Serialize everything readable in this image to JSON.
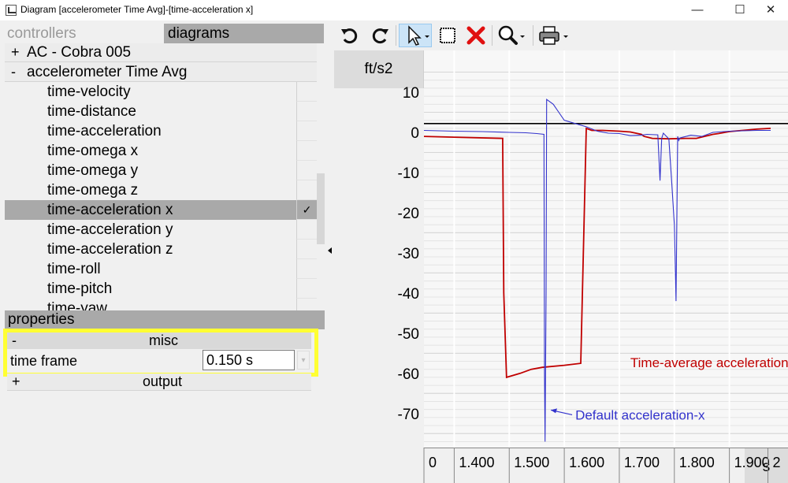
{
  "window": {
    "title": "Diagram [accelerometer Time Avg]-[time-acceleration x]",
    "minimize": "—",
    "maximize": "☐",
    "close": "✕"
  },
  "left": {
    "tabs": {
      "controllers": "controllers",
      "diagrams": "diagrams"
    },
    "tree": [
      {
        "expander": "+",
        "label": "AC - Cobra 005",
        "kind": "group",
        "checked": false
      },
      {
        "expander": "-",
        "label": "accelerometer Time Avg",
        "kind": "group",
        "checked": false
      },
      {
        "label": "time-velocity",
        "kind": "item",
        "checked": false
      },
      {
        "label": "time-distance",
        "kind": "item",
        "checked": false
      },
      {
        "label": "time-acceleration",
        "kind": "item",
        "checked": false
      },
      {
        "label": "time-omega x",
        "kind": "item",
        "checked": false
      },
      {
        "label": "time-omega y",
        "kind": "item",
        "checked": false
      },
      {
        "label": "time-omega z",
        "kind": "item",
        "checked": false
      },
      {
        "label": "time-acceleration x",
        "kind": "item",
        "checked": true,
        "check_mark": "✓"
      },
      {
        "label": "time-acceleration y",
        "kind": "item",
        "checked": false
      },
      {
        "label": "time-acceleration z",
        "kind": "item",
        "checked": false
      },
      {
        "label": "time-roll",
        "kind": "item",
        "checked": false
      },
      {
        "label": "time-pitch",
        "kind": "item",
        "checked": false
      },
      {
        "label": "time-yaw",
        "kind": "item",
        "checked": false
      }
    ],
    "properties": {
      "header": "properties",
      "misc": {
        "expander": "-",
        "label": "misc"
      },
      "time_frame": {
        "label": "time frame",
        "value": "0.150 s"
      },
      "output": {
        "expander": "+",
        "label": "output"
      }
    }
  },
  "toolbar": {
    "buttons": [
      "undo-icon",
      "redo-icon",
      "pointer-icon",
      "select-rect-icon",
      "delete-icon",
      "zoom-icon",
      "print-icon"
    ]
  },
  "chart_data": {
    "type": "line",
    "ylabel": "ft/s2",
    "xlabel": "s",
    "xlim": [
      1.345,
      1.975
    ],
    "ylim": [
      -77.5,
      15.5
    ],
    "yticks": [
      10,
      0,
      -10,
      -20,
      -30,
      -40,
      -50,
      -60,
      -70
    ],
    "xticks": [
      1.4,
      1.5,
      1.6,
      1.7,
      1.8,
      1.9
    ],
    "xtick_labels": [
      "0",
      "1.400",
      "1.500",
      "1.600",
      "1.700",
      "1.800",
      "1.900",
      "2"
    ],
    "xtick_label_values": [
      1.345,
      1.4,
      1.5,
      1.6,
      1.7,
      1.8,
      1.9,
      1.97
    ],
    "reference_line": {
      "y": 2.2,
      "color": "#000000"
    },
    "series": [
      {
        "name": "Time-average acceleration-x",
        "color": "#c00000",
        "x": [
          1.345,
          1.4,
          1.488,
          1.49,
          1.495,
          1.52,
          1.54,
          1.56,
          1.6,
          1.63,
          1.64,
          1.65,
          1.67,
          1.7,
          1.72,
          1.74,
          1.745,
          1.76,
          1.79,
          1.82,
          1.84,
          1.87,
          1.88,
          1.9,
          1.95,
          1.975
        ],
        "values": [
          -1,
          -1.2,
          -1.5,
          -40,
          -61,
          -60,
          -59,
          -58.5,
          -58,
          -57.5,
          1.0,
          0.5,
          0.5,
          0.3,
          0.1,
          -0.5,
          -1.0,
          -1.5,
          -1.6,
          -1.5,
          -1.5,
          -0.5,
          -0.3,
          0.2,
          0.8,
          1.0
        ]
      },
      {
        "name": "Default acceleration-x",
        "color": "#3333cc",
        "x": [
          1.345,
          1.4,
          1.45,
          1.5,
          1.53,
          1.55,
          1.563,
          1.564,
          1.565,
          1.567,
          1.568,
          1.57,
          1.58,
          1.59,
          1.6,
          1.62,
          1.64,
          1.66,
          1.68,
          1.7,
          1.72,
          1.74,
          1.75,
          1.77,
          1.774,
          1.777,
          1.78,
          1.79,
          1.795,
          1.8,
          1.803,
          1.806,
          1.808,
          1.81,
          1.83,
          1.85,
          1.87,
          1.9,
          1.95,
          1.975
        ],
        "values": [
          0.5,
          0.3,
          0.2,
          0.0,
          -0.1,
          -0.3,
          -0.5,
          -60,
          -77,
          -40,
          8.2,
          8.0,
          7.0,
          5.0,
          3.0,
          2.2,
          1.4,
          0.3,
          -0.2,
          -0.3,
          -0.8,
          -0.7,
          -0.5,
          -0.6,
          -12,
          -1.5,
          -0.2,
          -1.6,
          -12,
          -23,
          -42,
          -1.0,
          -2.0,
          -1.4,
          -0.7,
          -1.0,
          0.0,
          0.3,
          0.5,
          0.5
        ]
      }
    ],
    "annotations": [
      {
        "text": "Time-average acceleration-x",
        "color": "#c00000",
        "x": 1.72,
        "y": -58.5
      },
      {
        "text": "Default acceleration-x",
        "color": "#3333cc",
        "x": 1.62,
        "y": -71.5,
        "arrow_to": {
          "x": 1.567,
          "y": -71.5
        }
      }
    ],
    "grid": true
  }
}
